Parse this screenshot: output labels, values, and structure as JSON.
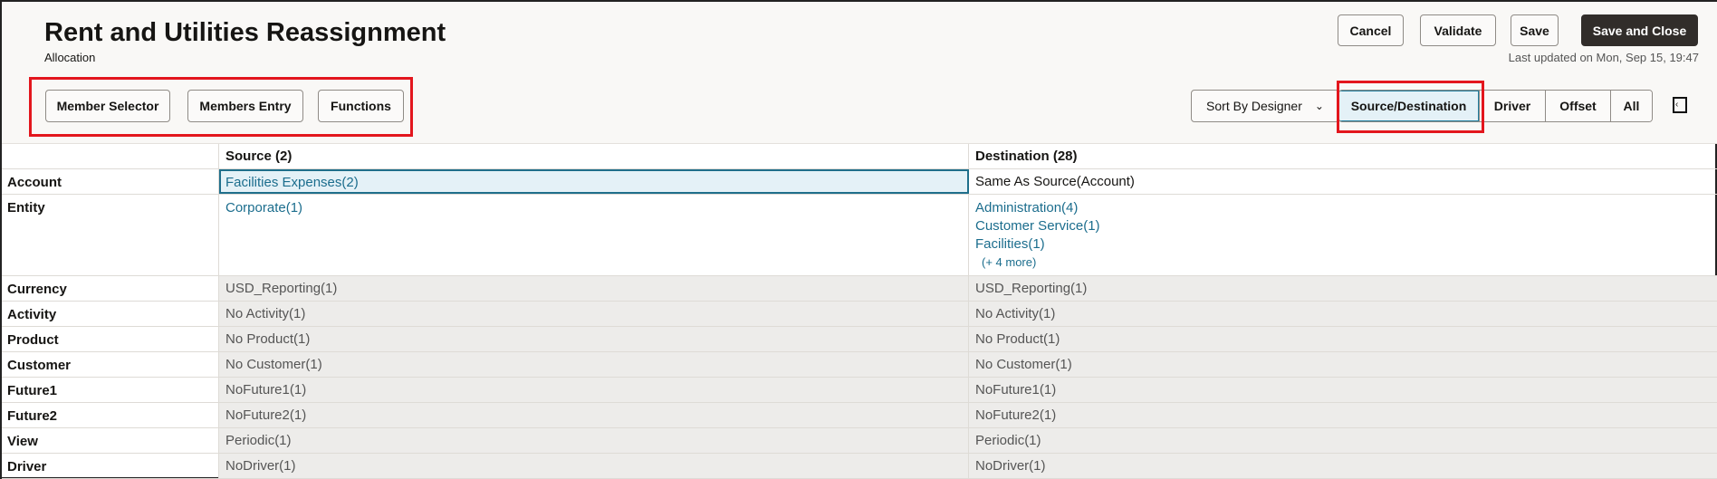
{
  "header": {
    "title": "Rent and Utilities Reassignment",
    "subtitle": "Allocation",
    "last_updated": "Last updated on Mon, Sep 15, 19:47"
  },
  "toolbar": {
    "member_selector": "Member Selector",
    "members_entry": "Members Entry",
    "functions": "Functions",
    "cancel": "Cancel",
    "validate": "Validate",
    "save": "Save",
    "save_close": "Save and Close",
    "sort": "Sort By Designer",
    "views": [
      "Source/Destination",
      "Driver",
      "Offset",
      "All"
    ]
  },
  "table": {
    "source_header": "Source (2)",
    "dest_header": "Destination (28)",
    "account": {
      "label": "Account",
      "source": "Facilities Expenses(2)",
      "dest": "Same As Source(Account)"
    },
    "entity": {
      "label": "Entity",
      "source": "Corporate(1)",
      "dest": [
        "Administration(4)",
        "Customer Service(1)",
        "Facilities(1)"
      ],
      "more": "(+ 4 more)"
    },
    "rows": [
      {
        "label": "Currency",
        "source": "USD_Reporting(1)",
        "dest": "USD_Reporting(1)"
      },
      {
        "label": "Activity",
        "source": "No Activity(1)",
        "dest": "No Activity(1)"
      },
      {
        "label": "Product",
        "source": "No Product(1)",
        "dest": "No Product(1)"
      },
      {
        "label": "Customer",
        "source": "No Customer(1)",
        "dest": "No Customer(1)"
      },
      {
        "label": "Future1",
        "source": "NoFuture1(1)",
        "dest": "NoFuture1(1)"
      },
      {
        "label": "Future2",
        "source": "NoFuture2(1)",
        "dest": "NoFuture2(1)"
      },
      {
        "label": "View",
        "source": "Periodic(1)",
        "dest": "Periodic(1)"
      },
      {
        "label": "Driver",
        "source": "NoDriver(1)",
        "dest": "NoDriver(1)"
      }
    ]
  }
}
